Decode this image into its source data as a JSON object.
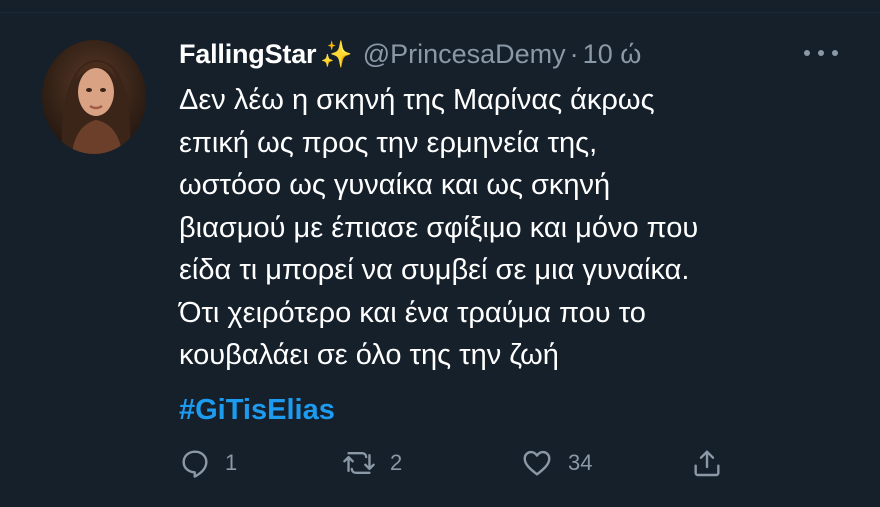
{
  "tweet": {
    "display_name": "FallingStar",
    "name_emoji": "✨",
    "handle": "@PrincesaDemy",
    "separator": "·",
    "time": "10 ώ",
    "text_lines": [
      "Δεν λέω η σκηνή της Μαρίνας άκρως",
      "επική ως προς την ερμηνεία της,",
      "ωστόσο ως γυναίκα και ως σκηνή",
      "βιασμού με έπιασε σφίξιμο και μόνο που",
      "είδα τι μπορεί να συμβεί σε μια γυναίκα.",
      "Ότι χειρότερο και ένα τραύμα που το",
      "κουβαλάει σε όλο της την ζωή"
    ],
    "hashtag": "#GiTisElias"
  },
  "actions": {
    "reply_count": "1",
    "retweet_count": "2",
    "like_count": "34"
  },
  "icons": {
    "more": "more-horizontal-icon",
    "reply": "reply-icon",
    "retweet": "retweet-icon",
    "like": "heart-icon",
    "share": "share-icon"
  },
  "colors": {
    "background": "#15202b",
    "text": "#ffffff",
    "secondary": "#8b98a5",
    "link": "#1d9bf0"
  }
}
